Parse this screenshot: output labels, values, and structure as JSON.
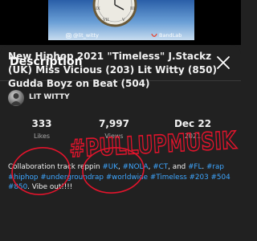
{
  "player": {
    "uploader_tag": "@lit_witty",
    "bandlab_tag": "BandLab"
  },
  "sheet": {
    "title": "Description"
  },
  "video": {
    "title": "New Hiphop 2021 \"Timeless\" J.Stackz (UK) Miss Vicious (203) Lit Witty (850) Gudda Boyz on Beat (504)"
  },
  "channel": {
    "name": "LIT WITTY"
  },
  "stats": {
    "likes_value": "333",
    "likes_label": "Likes",
    "views_value": "7,997",
    "views_label": "Views",
    "date_value": "Dec 22",
    "date_label": "2021"
  },
  "description": {
    "segments": [
      {
        "text": "Collaboration track reppin ",
        "tag": false
      },
      {
        "text": "#UK",
        "tag": true
      },
      {
        "text": ", ",
        "tag": false
      },
      {
        "text": "#NOLA",
        "tag": true
      },
      {
        "text": ", ",
        "tag": false
      },
      {
        "text": "#CT",
        "tag": true
      },
      {
        "text": ", and ",
        "tag": false
      },
      {
        "text": "#FL",
        "tag": true
      },
      {
        "text": ". ",
        "tag": false
      },
      {
        "text": "#rap",
        "tag": true
      },
      {
        "text": " ",
        "tag": false
      },
      {
        "text": "#hiphop",
        "tag": true
      },
      {
        "text": " ",
        "tag": false
      },
      {
        "text": "#undergroundrap",
        "tag": true
      },
      {
        "text": " ",
        "tag": false
      },
      {
        "text": "#worldwide",
        "tag": true
      },
      {
        "text": " ",
        "tag": false
      },
      {
        "text": "#Timeless",
        "tag": true
      },
      {
        "text": " ",
        "tag": false
      },
      {
        "text": "#203",
        "tag": true
      },
      {
        "text": " ",
        "tag": false
      },
      {
        "text": "#504",
        "tag": true
      },
      {
        "text": " ",
        "tag": false
      },
      {
        "text": "#850",
        "tag": true
      },
      {
        "text": ". Vibe out!!!!",
        "tag": false
      }
    ]
  },
  "annotation": {
    "scribble_text": "#PULLUPMUSIK",
    "color": "#e3142c"
  },
  "colors": {
    "background": "#212121",
    "hashtag": "#3ea6ff",
    "secondary_text": "#aaaaaa"
  }
}
